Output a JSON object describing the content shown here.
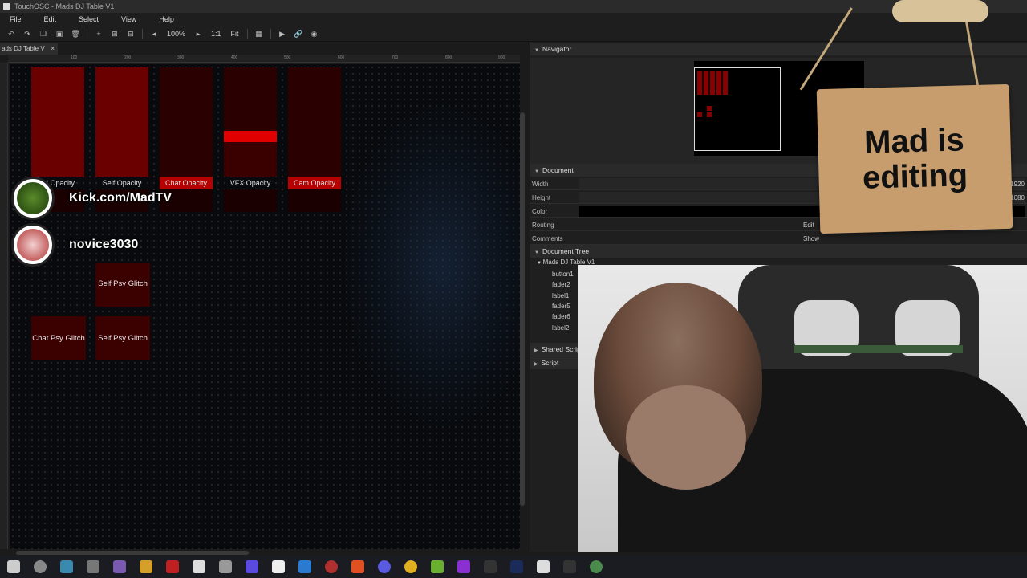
{
  "window": {
    "title": "TouchOSC - Mads DJ Table V1"
  },
  "menu": [
    "File",
    "Edit",
    "Select",
    "View",
    "Help"
  ],
  "toolbar": {
    "zoom": "100%",
    "ratio": "1:1",
    "fit": "Fit"
  },
  "doc_tab": {
    "label": "ads DJ Table V",
    "close": "×"
  },
  "ruler": [
    "100",
    "200",
    "300",
    "400",
    "500",
    "600",
    "700",
    "800",
    "900"
  ],
  "faders": [
    {
      "label": "IN Opacity",
      "value": 1.0,
      "highlight": false
    },
    {
      "label": "Self Opacity",
      "value": 1.0,
      "highlight": false
    },
    {
      "label": "Chat Opacity",
      "value": 0.0,
      "highlight": true
    },
    {
      "label": "VFX Opacity",
      "value": 0.42,
      "highlight": false
    },
    {
      "label": "Cam Opacity",
      "value": 0.0,
      "highlight": true
    }
  ],
  "glitch_buttons": [
    {
      "label": "Self Psy Glitch"
    },
    {
      "label": "Chat Psy Glitch"
    },
    {
      "label": "Self Psy Glitch"
    }
  ],
  "overlay": {
    "channel_text": "Kick.com/MadTV",
    "user_text": "novice3030",
    "sign_line1": "Mad is",
    "sign_line2": "editing"
  },
  "navigator": {
    "header": "Navigator"
  },
  "document": {
    "header": "Document",
    "rows": [
      {
        "key": "Width",
        "value": "1920"
      },
      {
        "key": "Height",
        "value": "1080"
      },
      {
        "key": "Color",
        "value": ""
      },
      {
        "key": "Routing",
        "value": "Edit"
      },
      {
        "key": "Comments",
        "value": "Show"
      }
    ]
  },
  "tree": {
    "header": "Document Tree",
    "root": "Mads DJ Table V1",
    "items": [
      "button1",
      "fader2",
      "label1",
      "fader5",
      "fader6",
      "label2"
    ]
  },
  "shared_scripts": {
    "header": "Shared Scripts"
  },
  "script": {
    "header": "Script"
  },
  "colors": {
    "accent_red": "#b70000",
    "dark_red": "#3b0000",
    "panel": "#1f1f1f"
  }
}
